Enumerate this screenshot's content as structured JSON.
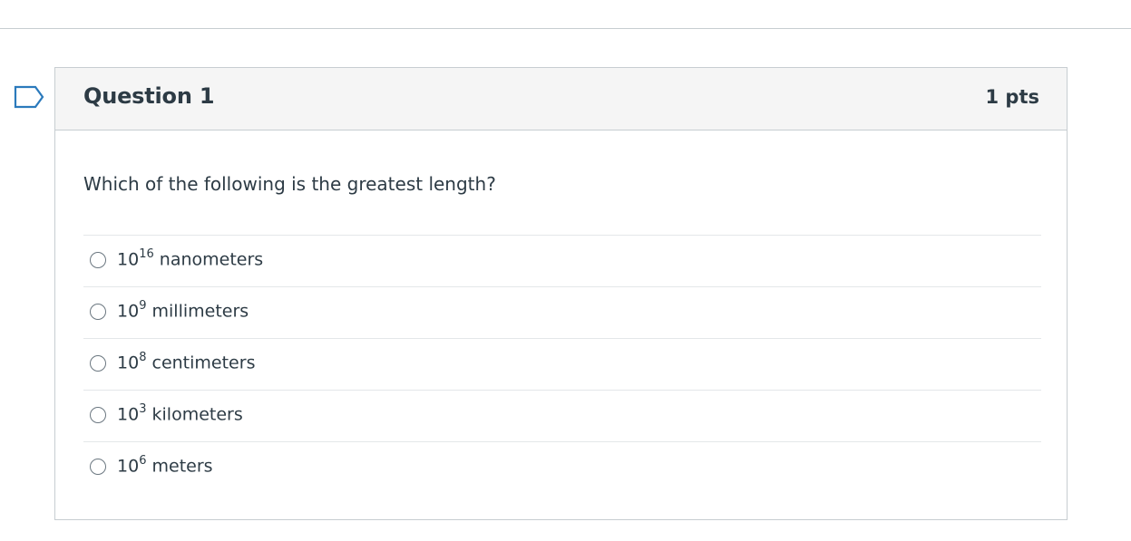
{
  "question": {
    "title": "Question 1",
    "points": "1 pts",
    "text": "Which of the following is the greatest length?",
    "answers": [
      {
        "base": "10",
        "exponent": "16",
        "unit": " nanometers",
        "selected": false
      },
      {
        "base": "10",
        "exponent": "9",
        "unit": " millimeters",
        "selected": false
      },
      {
        "base": "10",
        "exponent": "8",
        "unit": " centimeters",
        "selected": false
      },
      {
        "base": "10",
        "exponent": "3",
        "unit": " kilometers",
        "selected": false
      },
      {
        "base": "10",
        "exponent": "6",
        "unit": " meters",
        "selected": false
      }
    ]
  },
  "flag": {
    "icon": "bookmark-flag-icon",
    "color": "#2b7abc"
  },
  "colors": {
    "header_bg": "#f5f5f5",
    "border": "#c7cdd1",
    "text": "#2d3b45"
  }
}
